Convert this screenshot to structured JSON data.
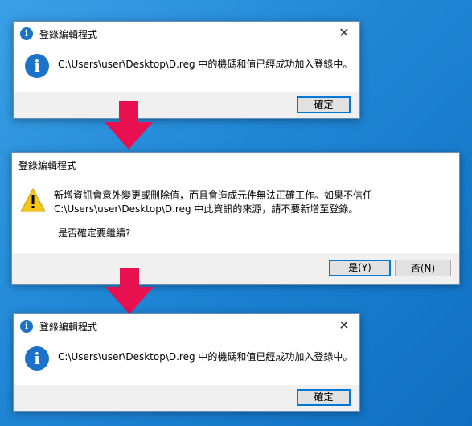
{
  "dialog1": {
    "title": "登錄編輯程式",
    "message": "C:\\Users\\user\\Desktop\\D.reg 中的機碼和值已經成功加入登錄中。",
    "ok_label": "確定"
  },
  "dialog2": {
    "title": "登錄編輯程式",
    "message_line1": "新增資訊會意外變更或刪除值，而且會造成元件無法正確工作。如果不信任",
    "message_line2": "C:\\Users\\user\\Desktop\\D.reg 中此資訊的來源，請不要新增至登錄。",
    "question": "是否確定要繼續?",
    "yes_label": "是(Y)",
    "no_label": "否(N)"
  },
  "dialog3": {
    "title": "登錄編輯程式",
    "message": "C:\\Users\\user\\Desktop\\D.reg 中的機碼和值已經成功加入登錄中。",
    "ok_label": "確定"
  },
  "icons": {
    "info": "info-icon",
    "warning": "warning-icon",
    "close": "close-icon",
    "flow_arrow": "arrow-down-icon"
  },
  "colors": {
    "accent": "#0078d7",
    "info_blue": "#1a73c9",
    "arrow_pink": "#e8104f",
    "warning_yellow": "#f5c518"
  }
}
